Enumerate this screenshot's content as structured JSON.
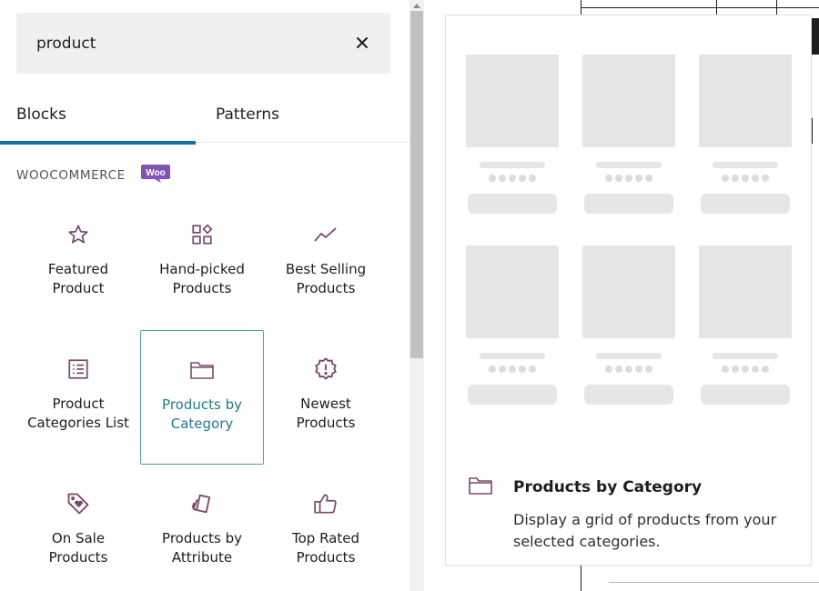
{
  "search": {
    "value": "product"
  },
  "tabs": [
    {
      "label": "Blocks",
      "active": true
    },
    {
      "label": "Patterns",
      "active": false
    }
  ],
  "section": {
    "title": "WOOCOMMERCE",
    "logo_text": "Woo"
  },
  "blocks": [
    {
      "label": "Featured Product",
      "icon": "star-icon"
    },
    {
      "label": "Hand-picked Products",
      "icon": "grid-shapes-icon"
    },
    {
      "label": "Best Selling Products",
      "icon": "trend-line-icon"
    },
    {
      "label": "Product Categories List",
      "icon": "list-icon"
    },
    {
      "label": "Products by Category",
      "icon": "folder-icon",
      "selected": true
    },
    {
      "label": "Newest Products",
      "icon": "exclamation-badge-icon"
    },
    {
      "label": "On Sale Products",
      "icon": "tag-heart-icon"
    },
    {
      "label": "Products by Attribute",
      "icon": "cards-icon"
    },
    {
      "label": "Top Rated Products",
      "icon": "thumbs-up-icon"
    }
  ],
  "preview": {
    "title": "Products by Category",
    "description": "Display a grid of products from your selected categories.",
    "icon": "folder-icon"
  },
  "colors": {
    "accent": "#0a73a8",
    "woo_purple": "#7f54b3",
    "icon_color": "#7a4a6c",
    "selected_border": "#4aa898",
    "selected_text": "#237a8a"
  }
}
